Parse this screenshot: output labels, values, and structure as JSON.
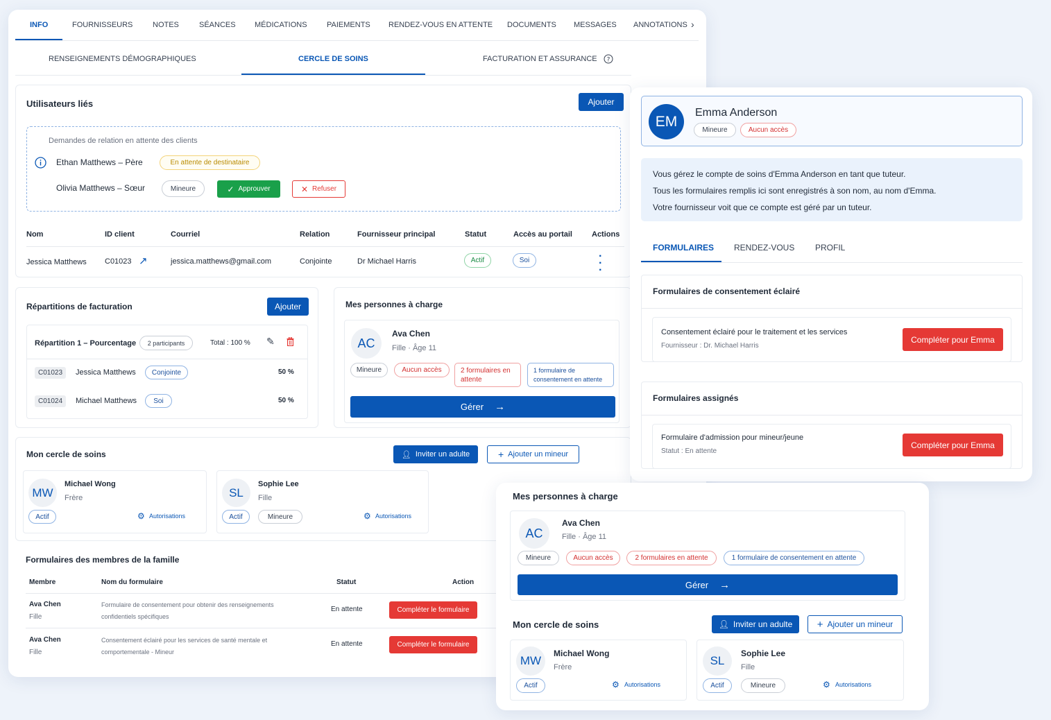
{
  "top_tabs": [
    "INFO",
    "FOURNISSEURS",
    "NOTES",
    "SÉANCES",
    "MÉDICATIONS",
    "PAIEMENTS",
    "RENDEZ-VOUS EN ATTENTE",
    "DOCUMENTS",
    "MESSAGES",
    "ANNOTATIONS"
  ],
  "sub_tabs": {
    "demo": "RENSEIGNEMENTS DÉMOGRAPHIQUES",
    "care": "CERCLE DE SOINS",
    "billing": "FACTURATION ET ASSURANCE"
  },
  "linked_users": {
    "title": "Utilisateurs liés",
    "add_label": "Ajouter",
    "pending_title": "Demandes de relation en attente des clients",
    "pending": [
      {
        "name": "Ethan Matthews – Père",
        "status": "En attente de destinataire"
      },
      {
        "name": "Olivia Matthews – Sœur",
        "badge": "Mineure",
        "approve": "Approuver",
        "reject": "Refuser"
      }
    ],
    "headers": [
      "Nom",
      "ID client",
      "Courriel",
      "Relation",
      "Fournisseur principal",
      "Statut",
      "Accès au portail",
      "Actions"
    ],
    "row": {
      "name": "Jessica Matthews",
      "id": "C01023",
      "email": "jessica.matthews@gmail.com",
      "relation": "Conjointe",
      "provider": "Dr Michael Harris",
      "status": "Actif",
      "portal": "Soi"
    }
  },
  "billing": {
    "title": "Répartitions de facturation",
    "add_label": "Ajouter",
    "split_title": "Répartition 1 – Pourcentage",
    "participants": "2 participants",
    "total": "Total : 100 %",
    "rows": [
      {
        "id": "C01023",
        "name": "Jessica Matthews",
        "role": "Conjointe",
        "pct": "50 %"
      },
      {
        "id": "C01024",
        "name": "Michael Matthews",
        "role": "Soi",
        "pct": "50 %"
      }
    ]
  },
  "dependents_left": {
    "title": "Mes personnes à charge",
    "initials": "AC",
    "name": "Ava Chen",
    "sub": "Fille · Âge 11",
    "badges": [
      "Mineure",
      "Aucun accès",
      "2 formulaires en attente",
      "1 formulaire de consentement en attente"
    ],
    "manage": "Gérer"
  },
  "care_circle_left": {
    "title": "Mon cercle de soins",
    "invite": "Inviter un adulte",
    "add_minor": "Ajouter un mineur",
    "people": [
      {
        "initials": "MW",
        "name": "Michael Wong",
        "relation": "Frère",
        "status": "Actif",
        "perm": "Autorisations"
      },
      {
        "initials": "SL",
        "name": "Sophie Lee",
        "relation": "Fille",
        "status": "Actif",
        "badge": "Mineure",
        "perm": "Autorisations"
      }
    ]
  },
  "family_forms": {
    "title": "Formulaires des membres de la famille",
    "headers": [
      "Membre",
      "Nom du formulaire",
      "Statut",
      "Action"
    ],
    "rows": [
      {
        "member": "Ava Chen",
        "rel": "Fille",
        "form1": "Formulaire de consentement pour obtenir des renseignements",
        "form2": "confidentiels spécifiques",
        "status": "En attente",
        "action": "Compléter le formulaire"
      },
      {
        "member": "Ava Chen",
        "rel": "Fille",
        "form1": "Consentement éclairé pour les services de santé mentale et",
        "form2": "comportementale - Mineur",
        "status": "En attente",
        "action": "Compléter le formulaire"
      }
    ]
  },
  "emma": {
    "initials": "EM",
    "name": "Emma Anderson",
    "badge1": "Mineure",
    "badge2": "Aucun accès",
    "info": [
      "Vous gérez le compte de soins d'Emma Anderson en tant que tuteur.",
      "Tous les formulaires remplis ici sont enregistrés à son nom, au nom d'Emma.",
      "Votre fournisseur voit que ce compte est géré par un tuteur."
    ],
    "tabs": [
      "FORMULAIRES",
      "RENDEZ-VOUS",
      "PROFIL"
    ],
    "consent_title": "Formulaires de consentement éclairé",
    "consent_item": "Consentement éclairé pour le traitement et les services",
    "consent_provider": "Fournisseur : Dr. Michael Harris",
    "assigned_title": "Formulaires assignés",
    "assigned_item": "Formulaire d'admission pour mineur/jeune",
    "assigned_status": "Statut : En attente",
    "complete": "Compléter pour Emma"
  },
  "dependents_right": {
    "title": "Mes personnes à charge",
    "initials": "AC",
    "name": "Ava Chen",
    "sub": "Fille · Âge 11",
    "badges": [
      "Mineure",
      "Aucun accès",
      "2 formulaires en attente",
      "1 formulaire de consentement en attente"
    ],
    "manage": "Gérer",
    "circle_title": "Mon cercle de soins",
    "invite": "Inviter un adulte",
    "add_minor": "Ajouter un mineur",
    "people": [
      {
        "initials": "MW",
        "name": "Michael Wong",
        "relation": "Frère",
        "status": "Actif",
        "perm": "Autorisations"
      },
      {
        "initials": "SL",
        "name": "Sophie Lee",
        "relation": "Fille",
        "status": "Actif",
        "badge": "Mineure",
        "perm": "Autorisations"
      }
    ]
  }
}
